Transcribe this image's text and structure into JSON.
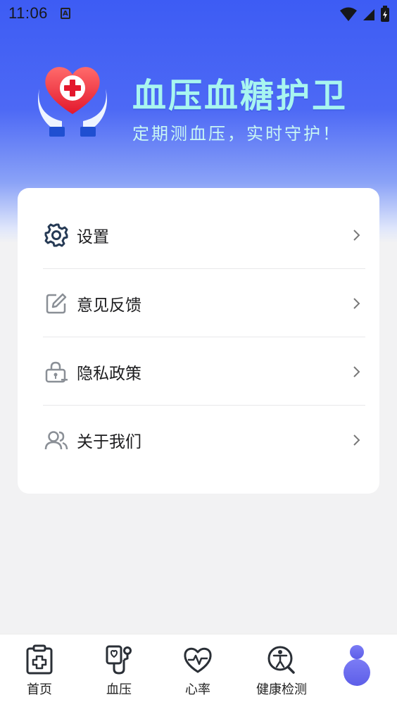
{
  "status_bar": {
    "time": "11:06",
    "notification_icon": "a-letter-icon",
    "icons": [
      "wifi-icon",
      "signal-icon",
      "battery-icon"
    ]
  },
  "header": {
    "title": "血压血糖护卫",
    "slogan": "定期测血压，实时守护！",
    "logo": "heart-cross-hands-logo"
  },
  "menu": {
    "items": [
      {
        "label": "设置",
        "icon": "gear-icon"
      },
      {
        "label": "意见反馈",
        "icon": "edit-icon"
      },
      {
        "label": "隐私政策",
        "icon": "lock-icon"
      },
      {
        "label": "关于我们",
        "icon": "users-icon"
      }
    ]
  },
  "bottom_nav": {
    "items": [
      {
        "label": "首页",
        "icon": "clipboard-plus-icon"
      },
      {
        "label": "血压",
        "icon": "stethoscope-icon"
      },
      {
        "label": "心率",
        "icon": "heart-pulse-icon"
      },
      {
        "label": "健康检测",
        "icon": "body-search-icon"
      },
      {
        "label": "",
        "icon": "profile-icon",
        "active": true
      }
    ]
  },
  "colors": {
    "brand_blue": "#3d5cf4",
    "title_cyan": "#a8f5f0",
    "active_purple": "#6b6cf0",
    "icon_dark": "#263a55"
  }
}
